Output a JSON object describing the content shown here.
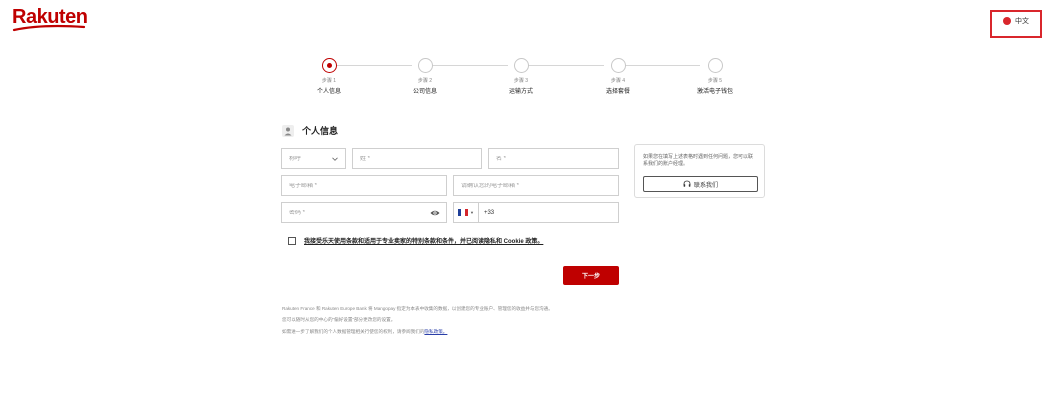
{
  "header": {
    "logo_text": "Rakuten",
    "language_label": "中文",
    "brand_color": "#bf0000"
  },
  "stepper": {
    "steps": [
      {
        "number": "步骤 1",
        "name": "个人信息",
        "active": true
      },
      {
        "number": "步骤 2",
        "name": "公司信息",
        "active": false
      },
      {
        "number": "步骤 3",
        "name": "运输方式",
        "active": false
      },
      {
        "number": "步骤 4",
        "name": "选择套餐",
        "active": false
      },
      {
        "number": "步骤 5",
        "name": "激活电子钱包",
        "active": false
      }
    ]
  },
  "form": {
    "section_title": "个人信息",
    "title_select_placeholder": "称呼",
    "last_name_placeholder": "姓 *",
    "first_name_placeholder": "名 *",
    "email_placeholder": "电子邮箱 *",
    "email_confirm_placeholder": "请确认您的电子邮箱 *",
    "password_placeholder": "密码 *",
    "phone_code": "+33",
    "terms_text": "我接受乐天使用条款和适用于专业卖家的特别条款和条件，并已阅读隐私和 Cookie 政策。",
    "next_button": "下一步"
  },
  "help_card": {
    "text": "如果您在填写上述表格时遇到任何问题，您可以联系我们的账户经理。",
    "contact_button": "联系我们"
  },
  "disclaimer": {
    "line1": "Rakuten France 和 Rakuten Europe Bank 将 Mangopay 指定为本表中收集的数据，以创建您的专业账户、管理您的收益并与您沟通。",
    "line2": "您可以随时从您的中心的“偏好设置”部分更改您的设置。",
    "line3_prefix": "如需进一步了解我们的个人数据管理相关行使您的权利，请参阅我们的",
    "line3_link": "隐私政策。"
  }
}
